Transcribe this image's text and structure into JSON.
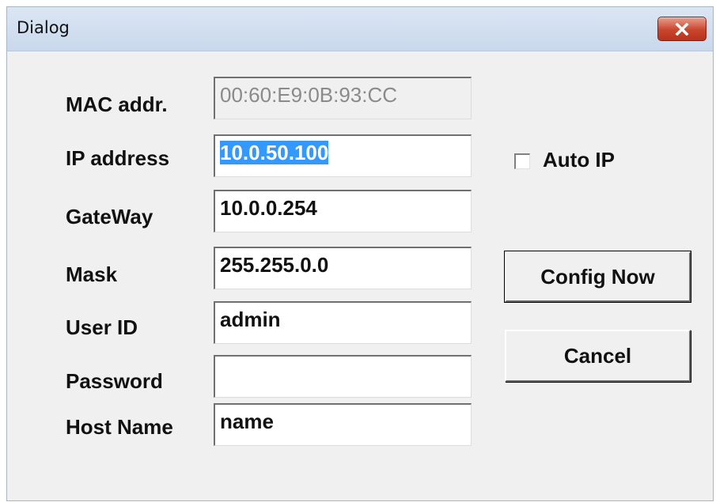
{
  "window": {
    "title": "Dialog",
    "close_icon": "close-x-icon"
  },
  "form": {
    "mac": {
      "label": "MAC addr.",
      "value": "00:60:E9:0B:93:CC"
    },
    "ip": {
      "label": "IP address",
      "value": "10.0.50.100"
    },
    "gateway": {
      "label": "GateWay",
      "value": "10.0.0.254"
    },
    "mask": {
      "label": "Mask",
      "value": "255.255.0.0"
    },
    "user_id": {
      "label": "User ID",
      "value": "admin"
    },
    "password": {
      "label": "Password",
      "value": ""
    },
    "host_name": {
      "label": "Host Name",
      "value": "name"
    }
  },
  "auto_ip": {
    "label": "Auto IP",
    "checked": false
  },
  "buttons": {
    "config_now": "Config Now",
    "cancel": "Cancel"
  },
  "colors": {
    "selection": "#3399ff",
    "close_button": "#c9452c",
    "titlebar": "#dbe6f4"
  }
}
